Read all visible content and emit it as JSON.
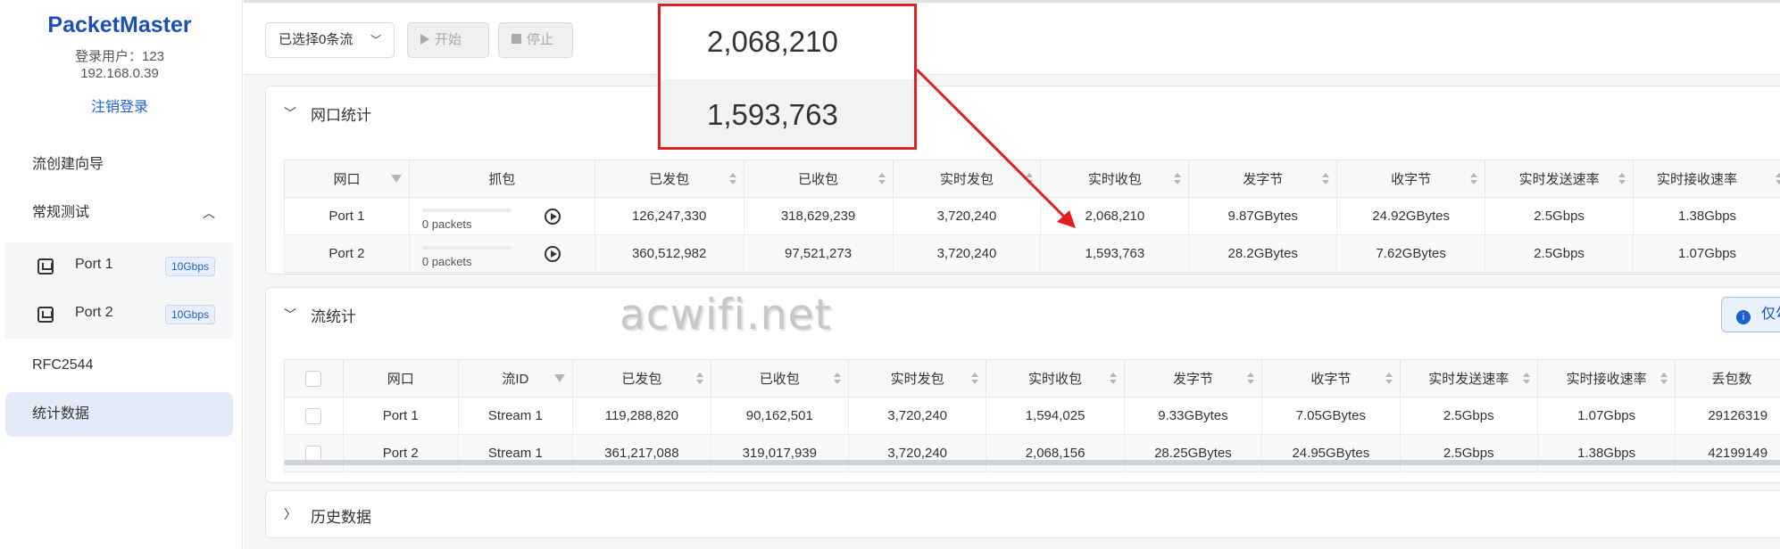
{
  "sidebar": {
    "brand": "PacketMaster",
    "user_line": "登录用户：123",
    "ip": "192.168.0.39",
    "logout": "注销登录",
    "nav": {
      "wizard": "流创建向导",
      "regular_test": "常规测试",
      "rfc": "RFC2544",
      "stats": "统计数据"
    },
    "ports": [
      {
        "label": "Port 1",
        "speed": "10Gbps"
      },
      {
        "label": "Port 2",
        "speed": "10Gbps"
      }
    ]
  },
  "toolbar": {
    "select_label": "已选择0条流",
    "start_label": "开始",
    "stop_label": "停止"
  },
  "port_stats": {
    "title": "网口统计",
    "headers": [
      "网口",
      "抓包",
      "已发包",
      "已收包",
      "实时发包",
      "实时收包",
      "发字节",
      "收字节",
      "实时发送速率",
      "实时接收速率"
    ],
    "rows": [
      {
        "port": "Port 1",
        "capture": "0 packets",
        "sent": "126,247,330",
        "recv": "318,629,239",
        "rt_sent": "3,720,240",
        "rt_recv": "2,068,210",
        "tx_bytes": "9.87GBytes",
        "rx_bytes": "24.92GBytes",
        "tx_rate": "2.5Gbps",
        "rx_rate": "1.38Gbps"
      },
      {
        "port": "Port 2",
        "capture": "0 packets",
        "sent": "360,512,982",
        "recv": "97,521,273",
        "rt_sent": "3,720,240",
        "rt_recv": "1,593,763",
        "tx_bytes": "28.2GBytes",
        "rx_bytes": "7.62GBytes",
        "tx_rate": "2.5Gbps",
        "rx_rate": "1.07Gbps"
      }
    ]
  },
  "flow_stats": {
    "title": "流统计",
    "info_label": "仅勾选",
    "headers": [
      "网口",
      "流ID",
      "已发包",
      "已收包",
      "实时发包",
      "实时收包",
      "发字节",
      "收字节",
      "实时发送速率",
      "实时接收速率",
      "丢包数"
    ],
    "rows": [
      {
        "port": "Port 1",
        "stream": "Stream 1",
        "sent": "119,288,820",
        "recv": "90,162,501",
        "rt_sent": "3,720,240",
        "rt_recv": "1,594,025",
        "tx_bytes": "9.33GBytes",
        "rx_bytes": "7.05GBytes",
        "tx_rate": "2.5Gbps",
        "rx_rate": "1.07Gbps",
        "lost": "29126319"
      },
      {
        "port": "Port 2",
        "stream": "Stream 1",
        "sent": "361,217,088",
        "recv": "319,017,939",
        "rt_sent": "3,720,240",
        "rt_recv": "2,068,156",
        "tx_bytes": "28.25GBytes",
        "rx_bytes": "24.95GBytes",
        "tx_rate": "2.5Gbps",
        "rx_rate": "1.38Gbps",
        "lost": "42199149"
      }
    ]
  },
  "history": {
    "title": "历史数据"
  },
  "callout": {
    "value1": "2,068,210",
    "value2": "1,593,763"
  },
  "watermark": "acwifi.net",
  "colors": {
    "accent": "#1e5fd0",
    "brand": "#1e4fb8",
    "callout": "#e41e1e"
  }
}
